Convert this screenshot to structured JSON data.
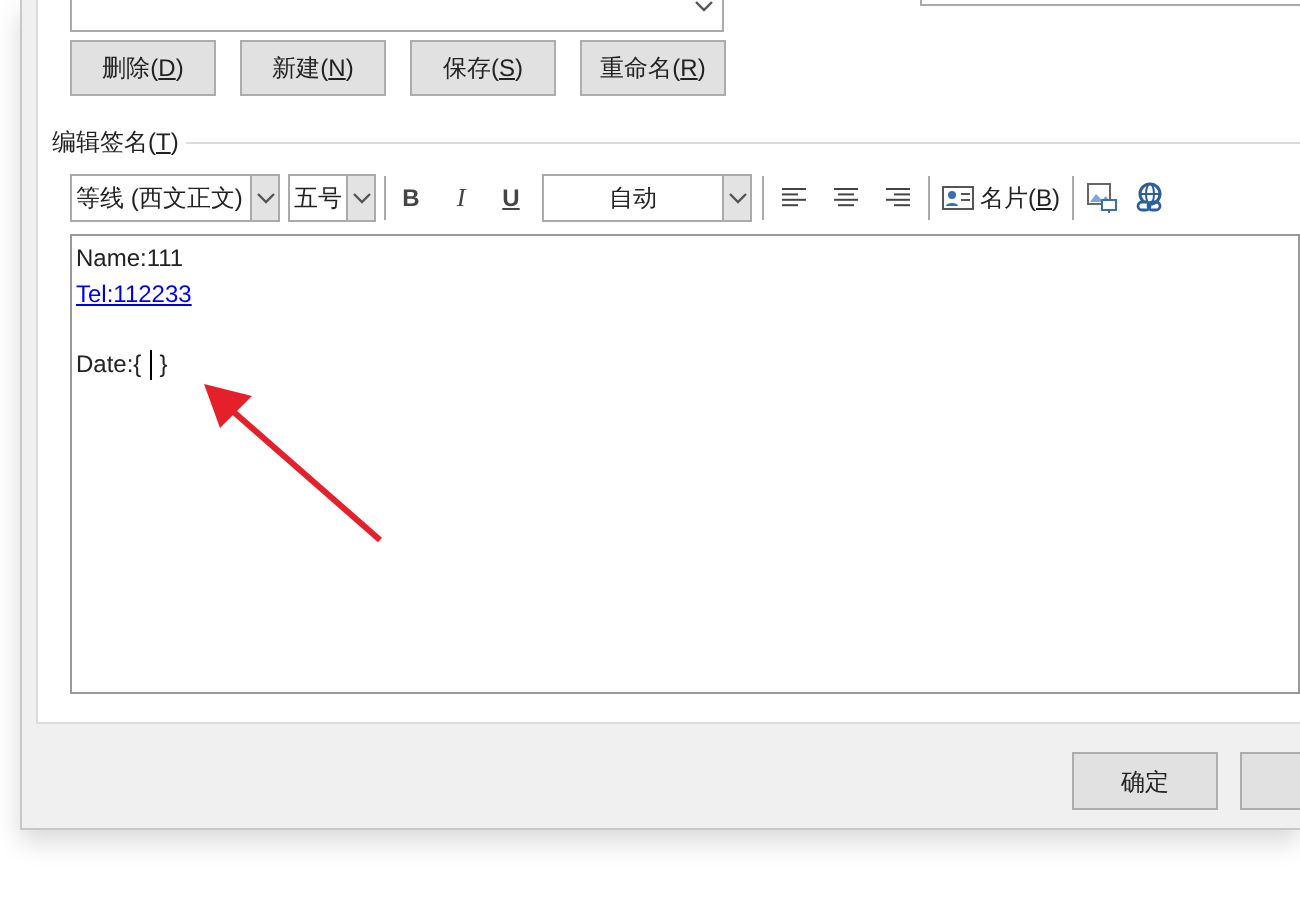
{
  "top_buttons": [
    {
      "before": "删除(",
      "key": "D",
      "after": ")"
    },
    {
      "before": "新建(",
      "key": "N",
      "after": ")"
    },
    {
      "before": "保存(",
      "key": "S",
      "after": ")"
    },
    {
      "before": "重命名(",
      "key": "R",
      "after": ")"
    }
  ],
  "edit_section": {
    "before": "编辑签名(",
    "key": "T",
    "after": ")"
  },
  "toolbar": {
    "font": "等线 (西文正文)",
    "size": "五号",
    "bold": "B",
    "italic": "I",
    "underline": "U",
    "color_select_text": "自动",
    "card_button": {
      "before": "名片(",
      "key": "B",
      "after": ")"
    }
  },
  "editor_lines": [
    {
      "kind": "text",
      "text": "Name:111"
    },
    {
      "kind": "link",
      "text": "Tel:112233"
    },
    {
      "kind": "blank"
    },
    {
      "kind": "caret",
      "before": "Date:{",
      "after": "}"
    }
  ],
  "footer_buttons": [
    {
      "label": "确定"
    }
  ],
  "cut_off_button_shown": true
}
